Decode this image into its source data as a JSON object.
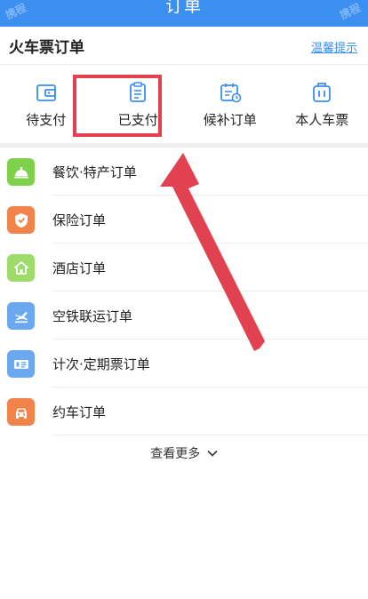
{
  "header": {
    "title": "订单",
    "watermark_left": "携程",
    "watermark_right": "携程"
  },
  "section": {
    "title": "火车票订单",
    "tips_link": "温馨提示"
  },
  "quick_actions": [
    {
      "label": "待支付",
      "icon": "wallet-icon"
    },
    {
      "label": "已支付",
      "icon": "paid-list-icon"
    },
    {
      "label": "候补订单",
      "icon": "calendar-waitlist-icon"
    },
    {
      "label": "本人车票",
      "icon": "luggage-ticket-icon"
    }
  ],
  "orders": [
    {
      "label": "餐饮·特产订单",
      "icon": "dining-bell-icon",
      "color": "#7ed14a"
    },
    {
      "label": "保险订单",
      "icon": "shield-icon",
      "color": "#f2834a"
    },
    {
      "label": "酒店订单",
      "icon": "hotel-house-icon",
      "color": "#9ddc6a"
    },
    {
      "label": "空铁联运订单",
      "icon": "plane-train-icon",
      "color": "#6aa9ef"
    },
    {
      "label": "计次·定期票订单",
      "icon": "ticket-pass-icon",
      "color": "#6aa9ef"
    },
    {
      "label": "约车订单",
      "icon": "car-icon",
      "color": "#f2834a"
    }
  ],
  "more": {
    "label": "查看更多"
  },
  "colors": {
    "header_bg": "#3b8ff0",
    "accent": "#3b8ff0",
    "highlight": "#e24150"
  }
}
